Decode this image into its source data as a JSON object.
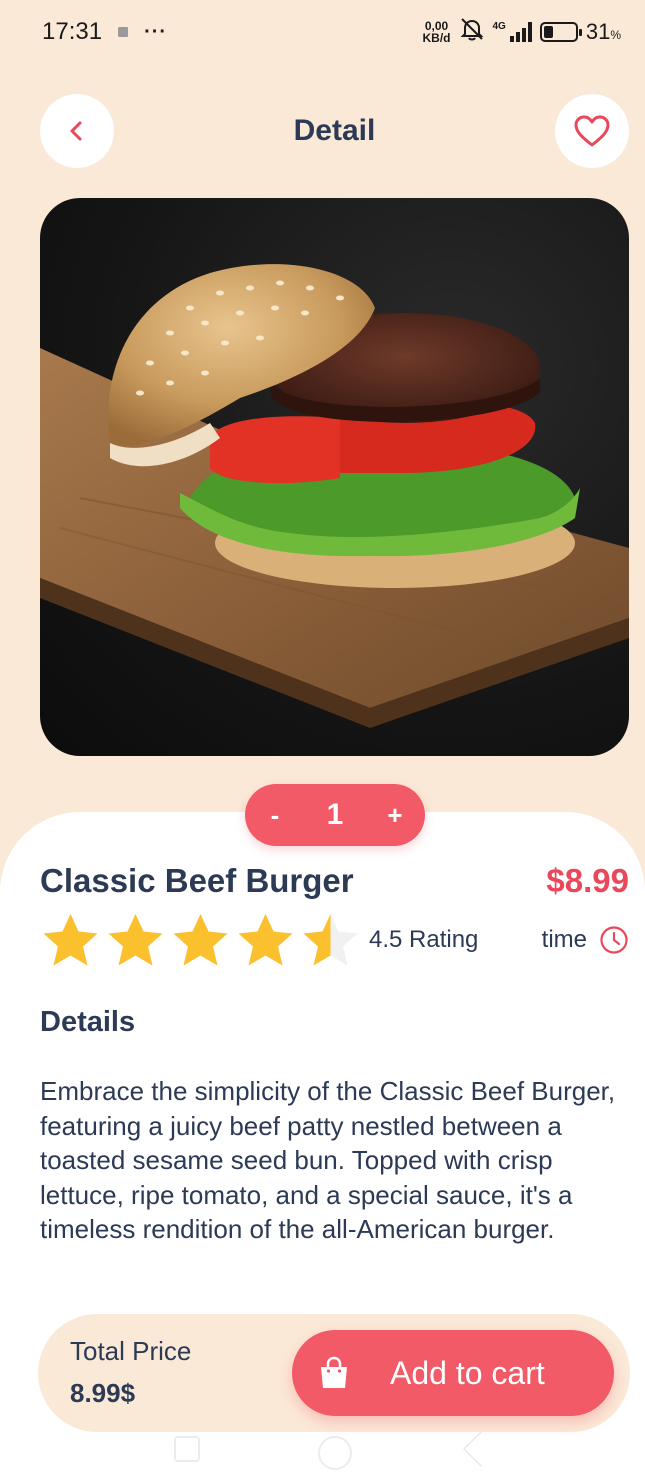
{
  "status_bar": {
    "time": "17:31",
    "more_indicator": "···",
    "net_speed_value": "0,00",
    "net_speed_unit": "KB/d",
    "network_type": "4G",
    "battery_percent": "31",
    "battery_percent_sign": "%",
    "battery_level": 0.31,
    "icons": [
      "notification-square-icon",
      "bell-off-icon",
      "signal-icon",
      "battery-icon"
    ]
  },
  "header": {
    "title": "Detail",
    "back_icon": "chevron-left-icon",
    "favorite_icon": "heart-outline-icon"
  },
  "product": {
    "name": "Classic Beef Burger",
    "price": "$8.99",
    "quantity": "1",
    "decrement_label": "-",
    "increment_label": "+",
    "rating_value": 4.5,
    "rating_max": 5,
    "rating_text": "4.5 Rating",
    "time_label": "time",
    "details_heading": "Details",
    "description": "Embrace the simplicity of the Classic Beef Burger, featuring a juicy beef patty nestled between a toasted sesame seed bun. Topped with crisp lettuce, ripe tomato, and a special sauce, it's a timeless rendition of the all-American burger."
  },
  "cart_bar": {
    "total_label": "Total Price",
    "total_value": "8.99$",
    "add_button_label": "Add to cart",
    "bag_icon": "shopping-bag-icon"
  },
  "colors": {
    "background": "#fbe9d8",
    "accent": "#f15a66",
    "price": "#e9485a",
    "text": "#2c3a55",
    "star": "#fbc02d"
  }
}
